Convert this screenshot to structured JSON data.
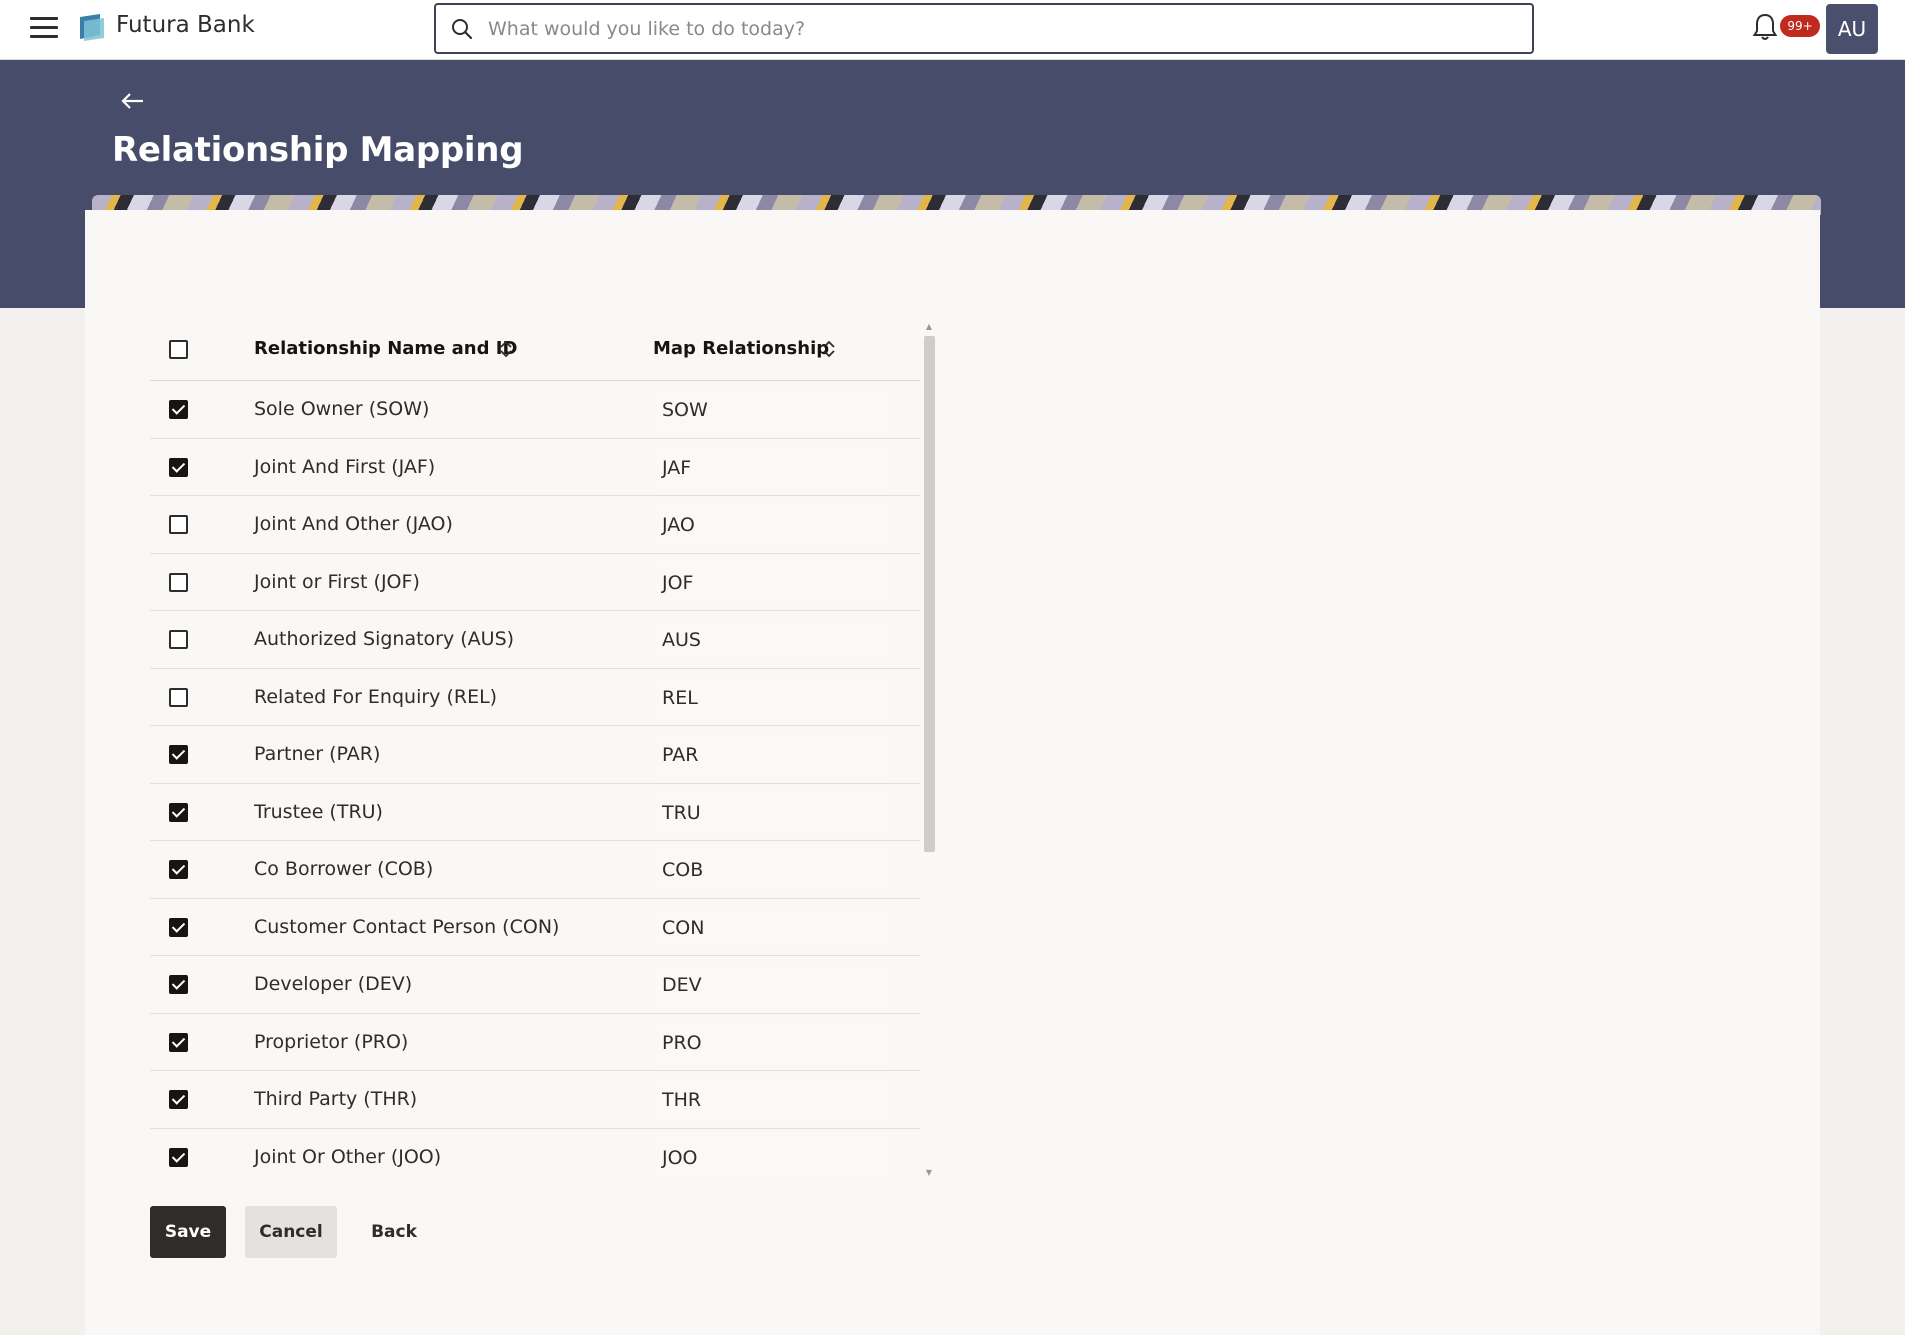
{
  "app": {
    "brand": "Futura Bank",
    "search_placeholder": "What would you like to do today?",
    "notification_badge": "99+",
    "avatar_initials": "AU"
  },
  "page": {
    "title": "Relationship Mapping"
  },
  "table": {
    "columns": {
      "name": "Relationship Name and ID",
      "map": "Map Relationship"
    },
    "select_all_checked": false,
    "rows": [
      {
        "name": "Sole Owner (SOW)",
        "map": "SOW",
        "checked": true
      },
      {
        "name": "Joint And First (JAF)",
        "map": "JAF",
        "checked": true
      },
      {
        "name": "Joint And Other (JAO)",
        "map": "JAO",
        "checked": false
      },
      {
        "name": "Joint or First (JOF)",
        "map": "JOF",
        "checked": false
      },
      {
        "name": "Authorized Signatory (AUS)",
        "map": "AUS",
        "checked": false
      },
      {
        "name": "Related For Enquiry (REL)",
        "map": "REL",
        "checked": false
      },
      {
        "name": "Partner (PAR)",
        "map": "PAR",
        "checked": true
      },
      {
        "name": "Trustee (TRU)",
        "map": "TRU",
        "checked": true
      },
      {
        "name": "Co Borrower (COB)",
        "map": "COB",
        "checked": true
      },
      {
        "name": "Customer Contact Person (CON)",
        "map": "CON",
        "checked": true
      },
      {
        "name": "Developer (DEV)",
        "map": "DEV",
        "checked": true
      },
      {
        "name": "Proprietor (PRO)",
        "map": "PRO",
        "checked": true
      },
      {
        "name": "Third Party (THR)",
        "map": "THR",
        "checked": true
      },
      {
        "name": "Joint Or Other (JOO)",
        "map": "JOO",
        "checked": true
      }
    ]
  },
  "actions": {
    "save": "Save",
    "cancel": "Cancel",
    "back": "Back"
  }
}
